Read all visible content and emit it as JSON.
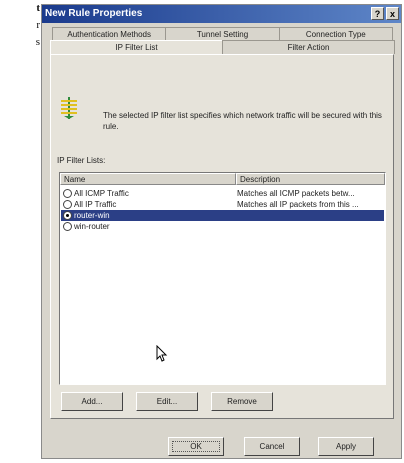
{
  "side_text": {
    "line1": "t",
    "line2": "r",
    "line3": "s"
  },
  "window": {
    "title": "New Rule Properties",
    "help_glyph": "?",
    "close_glyph": "x"
  },
  "tabs": {
    "back": [
      "Authentication Methods",
      "Tunnel Setting",
      "Connection Type"
    ],
    "front": [
      "IP Filter List",
      "Filter Action"
    ],
    "active": "IP Filter List"
  },
  "description": "The selected IP filter list specifies which network traffic will be secured with this rule.",
  "filter_lists_label": "IP Filter Lists:",
  "list": {
    "columns": {
      "name": "Name",
      "description": "Description"
    },
    "rows": [
      {
        "name": "All ICMP Traffic",
        "description": "Matches all ICMP packets betw...",
        "selected": false
      },
      {
        "name": "All IP Traffic",
        "description": "Matches all IP packets from this ...",
        "selected": false
      },
      {
        "name": "router-win",
        "description": "",
        "selected": true
      },
      {
        "name": "win-router",
        "description": "",
        "selected": false
      }
    ]
  },
  "buttons": {
    "add": "Add...",
    "edit": "Edit...",
    "remove": "Remove",
    "ok": "OK",
    "cancel": "Cancel",
    "apply": "Apply"
  },
  "colors": {
    "title_bar": "#1a3a8c",
    "selection": "#2b3f86",
    "dialog_face": "#d8d5cc",
    "icon_yellow": "#e0c020",
    "icon_green": "#2e8b3a"
  },
  "icons": {
    "filter_icon": "filter-list-icon",
    "cursor": "mouse-pointer-icon"
  }
}
